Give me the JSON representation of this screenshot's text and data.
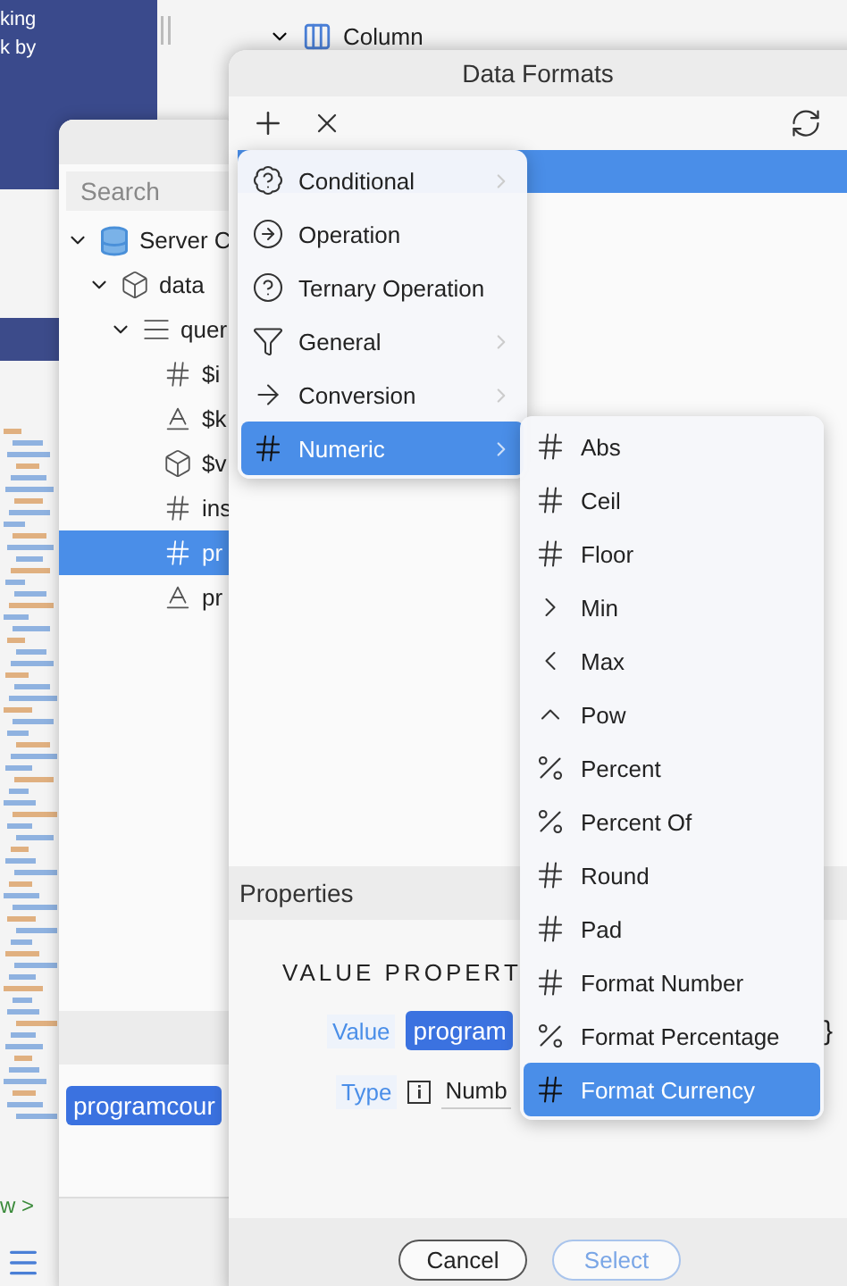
{
  "background_app": {
    "banner_lines": [
      "king",
      "k by"
    ],
    "tree": [
      {
        "label": "Column",
        "expanded": true
      }
    ],
    "breadcrumb": "w >"
  },
  "tree_window": {
    "search": {
      "placeholder": "Search"
    },
    "tree": [
      {
        "label": "Server C",
        "kind": "database",
        "expanded": true,
        "selected": false,
        "children": [
          {
            "label": "data",
            "kind": "cube",
            "expanded": true,
            "selected": false,
            "children": [
              {
                "label": "quer",
                "kind": "list",
                "expanded": true,
                "selected": false,
                "children": [
                  {
                    "label": "$i",
                    "kind": "hash",
                    "selected": false
                  },
                  {
                    "label": "$k",
                    "kind": "text",
                    "selected": false
                  },
                  {
                    "label": "$v",
                    "kind": "cube",
                    "selected": false
                  },
                  {
                    "label": "ins",
                    "kind": "hash",
                    "selected": false
                  },
                  {
                    "label": "pr",
                    "kind": "hash",
                    "selected": true
                  },
                  {
                    "label": "pr",
                    "kind": "text",
                    "selected": false
                  }
                ]
              }
            ]
          }
        ]
      }
    ],
    "chip": "programcour"
  },
  "dialog": {
    "title": "Data Formats",
    "rows": [
      {
        "selected": true
      }
    ],
    "menu": [
      {
        "label": "Conditional",
        "kind": "conditional",
        "submenu": true,
        "selected": false
      },
      {
        "label": "Operation",
        "kind": "operation",
        "submenu": false,
        "selected": false
      },
      {
        "label": "Ternary Operation",
        "kind": "ternary",
        "submenu": false,
        "selected": false
      },
      {
        "label": "General",
        "kind": "filter",
        "submenu": true,
        "selected": false
      },
      {
        "label": "Conversion",
        "kind": "arrow",
        "submenu": true,
        "selected": false
      },
      {
        "label": "Numeric",
        "kind": "hash",
        "submenu": true,
        "selected": true
      }
    ],
    "submenu": [
      {
        "label": "Abs",
        "kind": "hash",
        "selected": false
      },
      {
        "label": "Ceil",
        "kind": "hash",
        "selected": false
      },
      {
        "label": "Floor",
        "kind": "hash",
        "selected": false
      },
      {
        "label": "Min",
        "kind": "greater",
        "selected": false
      },
      {
        "label": "Max",
        "kind": "less",
        "selected": false
      },
      {
        "label": "Pow",
        "kind": "caret",
        "selected": false
      },
      {
        "label": "Percent",
        "kind": "percent",
        "selected": false
      },
      {
        "label": "Percent Of",
        "kind": "percent",
        "selected": false
      },
      {
        "label": "Round",
        "kind": "hash",
        "selected": false
      },
      {
        "label": "Pad",
        "kind": "hash",
        "selected": false
      },
      {
        "label": "Format Number",
        "kind": "hash",
        "selected": false
      },
      {
        "label": "Format Percentage",
        "kind": "percent",
        "selected": false
      },
      {
        "label": "Format Currency",
        "kind": "hash",
        "selected": true
      }
    ],
    "properties": {
      "header": "Properties",
      "section": "VALUE PROPERT",
      "fields": [
        {
          "label": "Value",
          "kind": "chip",
          "value": "program",
          "suffix": "}"
        },
        {
          "label": "Type",
          "kind": "select",
          "value": "Numb"
        }
      ]
    },
    "buttons": [
      {
        "label": "Cancel",
        "kind": "secondary",
        "disabled": false
      },
      {
        "label": "Select",
        "kind": "primary",
        "disabled": true
      }
    ]
  }
}
